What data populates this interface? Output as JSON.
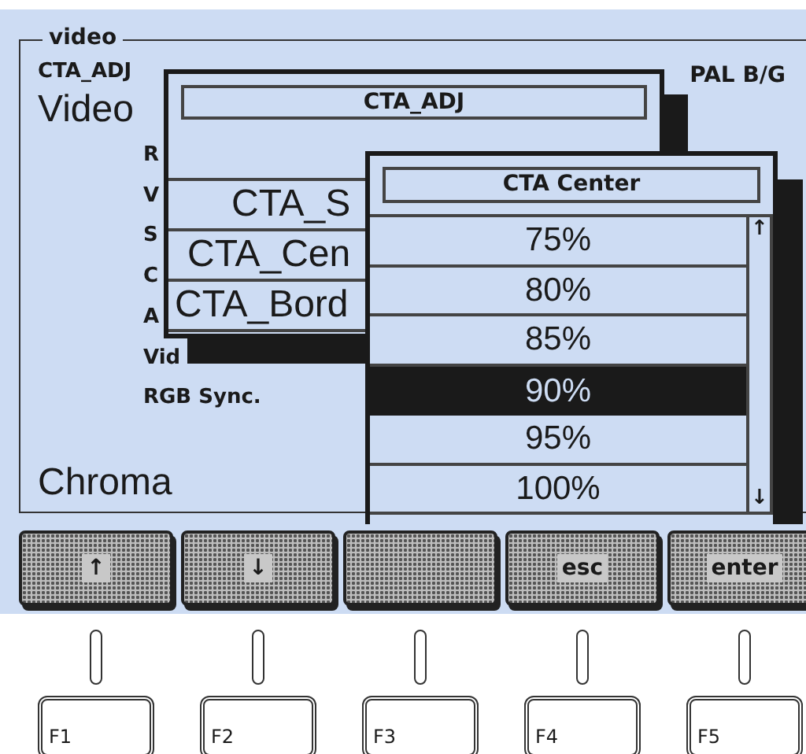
{
  "screen": {
    "group_title": "video",
    "mode": "CTA_ADJ",
    "heading": "Video",
    "standard": "PAL B/G",
    "menu_items": [
      "R",
      "V",
      "S",
      "C",
      "A",
      "Vid",
      "RGB Sync."
    ],
    "footer": "Chroma"
  },
  "submenu": {
    "title": "CTA_ADJ",
    "items": [
      "CTA_S",
      "CTA_Cen",
      "CTA_Bord"
    ]
  },
  "popup": {
    "title": "CTA Center",
    "scroll_up": "↑",
    "scroll_down": "↓",
    "options": [
      {
        "label": "75%",
        "selected": false
      },
      {
        "label": "80%",
        "selected": false
      },
      {
        "label": "85%",
        "selected": false
      },
      {
        "label": "90%",
        "selected": true
      },
      {
        "label": "95%",
        "selected": false
      },
      {
        "label": "100%",
        "selected": false
      }
    ]
  },
  "function_keys": [
    {
      "softkey": "↑",
      "key": "F1"
    },
    {
      "softkey": "↓",
      "key": "F2"
    },
    {
      "key": "F3"
    },
    {
      "softkey": "esc",
      "key": "F4"
    },
    {
      "softkey": "enter",
      "key": "F5"
    }
  ]
}
